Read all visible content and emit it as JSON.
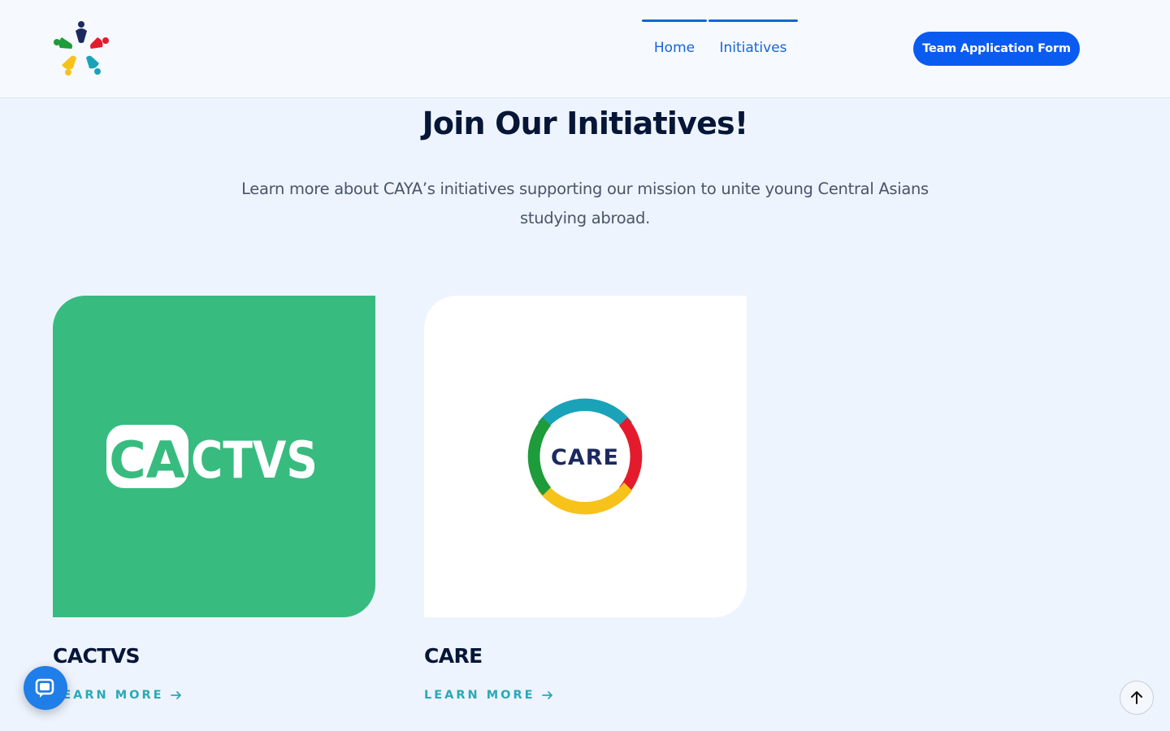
{
  "header": {
    "nav": [
      {
        "label": "Home"
      },
      {
        "label": "Initiatives"
      }
    ],
    "cta_label": "Team Application Form"
  },
  "hero": {
    "title": "Join Our Initiatives!",
    "subtitle": "Learn more about CAYA’s initiatives supporting our mission to unite young Central Asians studying abroad."
  },
  "cards": [
    {
      "title": "CACTVS",
      "logo_left": "CA",
      "logo_right": "CTVS",
      "link": "LEARN MORE",
      "bg": "#38bb7f"
    },
    {
      "title": "CARE",
      "logo_text": "CARE",
      "link": "LEARN MORE",
      "bg": "#ffffff"
    }
  ],
  "colors": {
    "primary": "#0a5cf0",
    "nav": "#1565d8",
    "teal": "#2aa8b8",
    "green": "#38bb7f"
  },
  "icons": {
    "logo": "caya-logo-icon",
    "chat": "chat-icon",
    "scroll_top": "arrow-up-icon",
    "link_arrow": "arrow-right-icon"
  }
}
